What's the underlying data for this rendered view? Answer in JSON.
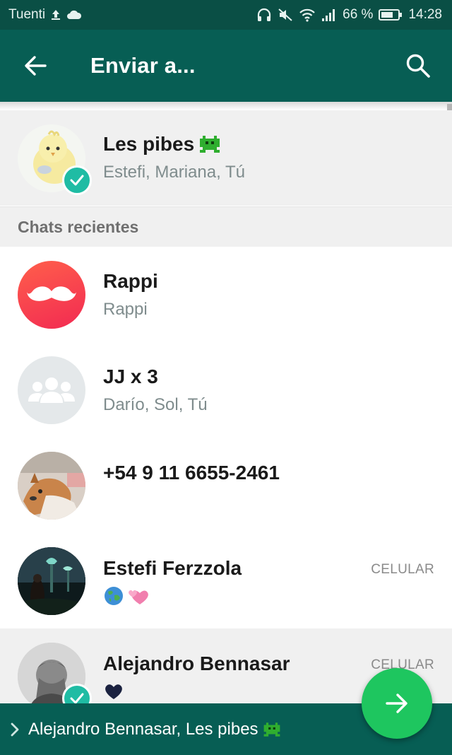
{
  "status_bar": {
    "carrier": "Tuenti",
    "battery": "66 %",
    "time": "14:28"
  },
  "app_bar": {
    "title": "Enviar a..."
  },
  "selected_group": {
    "name": "Les pibes",
    "name_emoji": "alien-monster",
    "members": "Estefi, Mariana, Tú",
    "selected": true
  },
  "section": {
    "title": "Chats recientes"
  },
  "chats": [
    {
      "name": "Rappi",
      "subtitle": "Rappi",
      "tag": "",
      "selected": false
    },
    {
      "name": "JJ x 3",
      "subtitle": "Darío, Sol, Tú",
      "tag": "",
      "selected": false
    },
    {
      "name": "+54 9 11 6655-2461",
      "subtitle": "",
      "tag": "",
      "selected": false
    },
    {
      "name": "Estefi Ferzzola",
      "subtitle_emojis": [
        "globe-emoji",
        "hearts-emoji"
      ],
      "tag": "CELULAR",
      "selected": false
    },
    {
      "name": "Alejandro Bennasar",
      "subtitle_emojis": [
        "black-heart-emoji"
      ],
      "tag": "CELULAR",
      "selected": true
    }
  ],
  "bottom_bar": {
    "recipients": "Alejandro Bennasar, Les pibes"
  },
  "colors": {
    "status_bar": "#0a4f45",
    "app_bar": "#075e54",
    "check": "#1fbca4",
    "fab": "#1ec65f",
    "selected_row": "#f0f0f0"
  }
}
